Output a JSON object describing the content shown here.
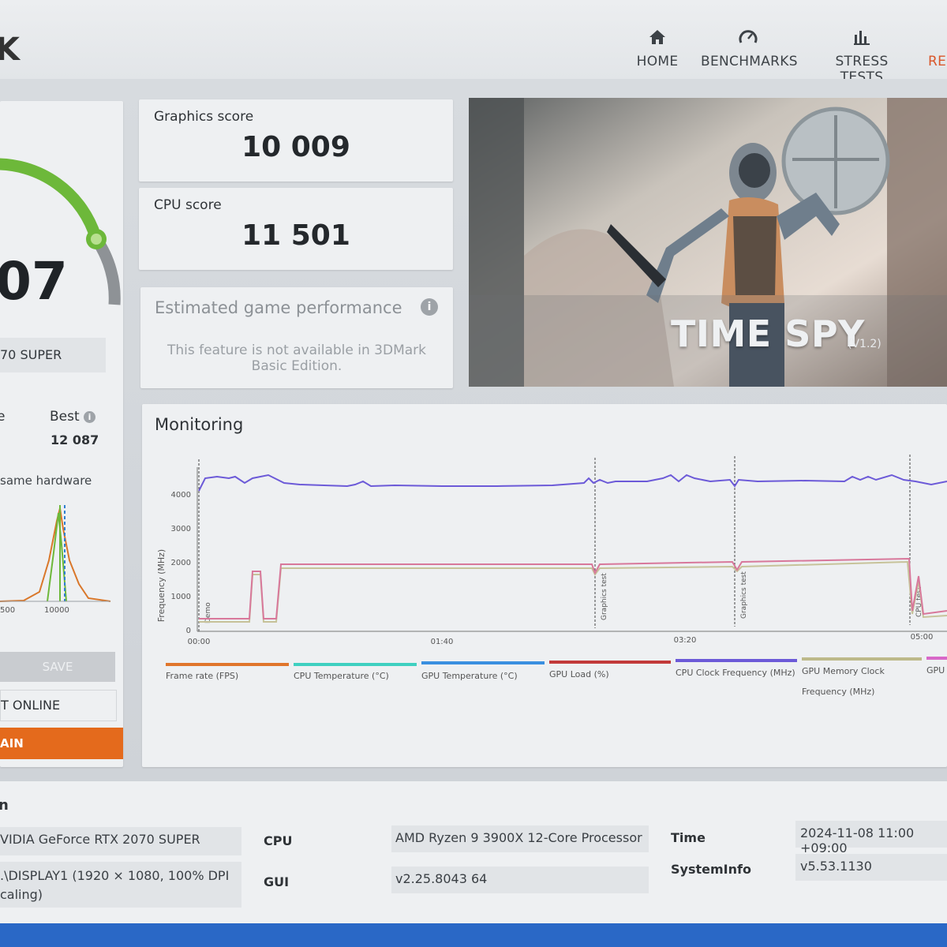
{
  "nav": {
    "items": [
      {
        "label": "HOME",
        "icon": "home-icon"
      },
      {
        "label": "BENCHMARKS",
        "icon": "gauge-icon"
      },
      {
        "label": "STRESS TESTS",
        "icon": "bar-chart-icon"
      },
      {
        "label": "RES",
        "icon": "results-icon"
      }
    ]
  },
  "score_panel": {
    "score_fragment": "07",
    "gpu_fragment": "70 SUPER",
    "label_fragment": "e",
    "best_label": "Best",
    "best_value": "12 087",
    "hardware_fragment": "same hardware",
    "dist_labels": [
      "500",
      "10000"
    ],
    "save_label": "SAVE",
    "online_fragment": "T ONLINE",
    "again_fragment": "AIN",
    "accent": "#e46a1c",
    "gauge_color": "#6db83a"
  },
  "scores": {
    "graphics_label": "Graphics score",
    "graphics_value": "10 009",
    "cpu_label": "CPU score",
    "cpu_value": "11 501"
  },
  "estimated": {
    "title": "Estimated game performance",
    "message": "This feature is not available in 3DMark Basic Edition."
  },
  "hero": {
    "title": "TIME SPY",
    "version": "(V1.2)"
  },
  "monitoring": {
    "title": "Monitoring",
    "ylabel": "Frequency (MHz)",
    "yticks": [
      "4000",
      "3000",
      "2000",
      "1000",
      "0"
    ],
    "xticks": [
      "00:00",
      "01:40",
      "03:20",
      "05:00"
    ],
    "markers": [
      "Demo",
      "Graphics test",
      "Graphics test",
      "CPU test"
    ],
    "legend": [
      {
        "label": "Frame rate (FPS)",
        "color": "#e0762c"
      },
      {
        "label": "CPU Temperature (°C)",
        "color": "#3fd0c0"
      },
      {
        "label": "GPU Temperature (°C)",
        "color": "#3a8fe0"
      },
      {
        "label": "GPU Load (%)",
        "color": "#c23a3a"
      },
      {
        "label": "CPU Clock Frequency (MHz)",
        "color": "#6c5ad8"
      },
      {
        "label": "GPU Memory Clock",
        "label2": "Frequency (MHz)",
        "color": "#bdb98a"
      },
      {
        "label": "GPU",
        "color": "#d868c8"
      }
    ]
  },
  "system": {
    "heading_fragment": "n",
    "gpu_value": "VIDIA GeForce RTX 2070 SUPER",
    "display_value_line1": ".\\DISPLAY1 (1920 × 1080, 100% DPI",
    "display_value_line2": "caling)",
    "cpu_label": "CPU",
    "cpu_value": "AMD Ryzen 9 3900X 12-Core Processor",
    "gui_label": "GUI",
    "gui_value": "v2.25.8043 64",
    "time_label": "Time",
    "time_value": "2024-11-08 11:00 +09:00",
    "sysinfo_label": "SystemInfo",
    "sysinfo_value": "v5.53.1130"
  }
}
